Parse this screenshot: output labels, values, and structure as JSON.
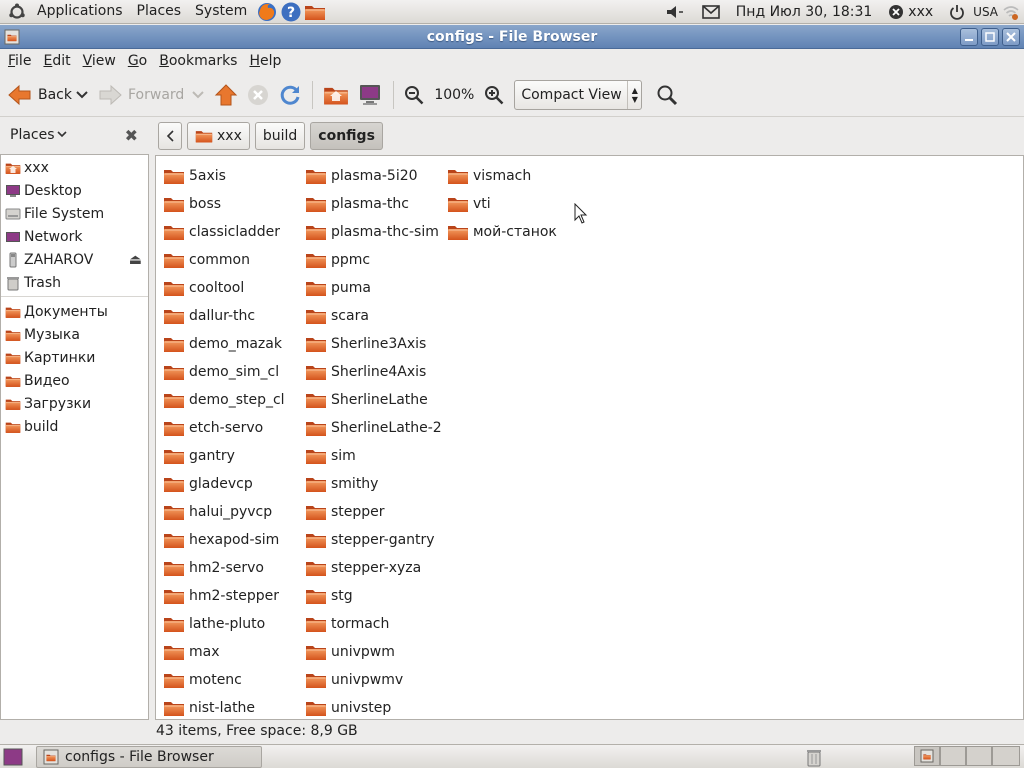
{
  "top_panel": {
    "menus": [
      "Applications",
      "Places",
      "System"
    ],
    "clock": "Пнд Июл 30, 18:31",
    "user": "xxx",
    "keyboard": "USA"
  },
  "window": {
    "title": "configs - File Browser"
  },
  "menubar": {
    "file": "F",
    "file_rest": "ile",
    "edit": "E",
    "edit_rest": "dit",
    "view": "V",
    "view_rest": "iew",
    "go": "G",
    "go_rest": "o",
    "bookmarks": "B",
    "bookmarks_rest": "ookmarks",
    "help": "H",
    "help_rest": "elp"
  },
  "toolbar": {
    "back": "Back",
    "forward": "Forward",
    "zoom": "100%",
    "view_mode": "Compact View"
  },
  "side_pane": {
    "header": "Places",
    "items": [
      {
        "label": "xxx",
        "icon": "home-folder-icon"
      },
      {
        "label": "Desktop",
        "icon": "desktop-icon"
      },
      {
        "label": "File System",
        "icon": "drive-icon"
      },
      {
        "label": "Network",
        "icon": "network-icon"
      },
      {
        "label": "ZAHAROV",
        "icon": "usb-drive-icon"
      },
      {
        "label": "Trash",
        "icon": "trash-icon"
      }
    ],
    "bookmarks": [
      {
        "label": "Документы",
        "icon": "documents-folder-icon"
      },
      {
        "label": "Музыка",
        "icon": "music-folder-icon"
      },
      {
        "label": "Картинки",
        "icon": "pictures-folder-icon"
      },
      {
        "label": "Видео",
        "icon": "videos-folder-icon"
      },
      {
        "label": "Загрузки",
        "icon": "downloads-folder-icon"
      },
      {
        "label": "build",
        "icon": "folder-icon"
      }
    ]
  },
  "path_bar": {
    "segments": [
      "xxx",
      "build",
      "configs"
    ]
  },
  "files": {
    "col1": [
      "5axis",
      "boss",
      "classicladder",
      "common",
      "cooltool",
      "dallur-thc",
      "demo_mazak",
      "demo_sim_cl",
      "demo_step_cl",
      "etch-servo",
      "gantry",
      "gladevcp",
      "halui_pyvcp",
      "hexapod-sim",
      "hm2-servo",
      "hm2-stepper",
      "lathe-pluto",
      "max",
      "motenc",
      "nist-lathe"
    ],
    "col2": [
      "plasma-5i20",
      "plasma-thc",
      "plasma-thc-sim",
      "ppmc",
      "puma",
      "scara",
      "Sherline3Axis",
      "Sherline4Axis",
      "SherlineLathe",
      "SherlineLathe-2",
      "sim",
      "smithy",
      "stepper",
      "stepper-gantry",
      "stepper-xyza",
      "stg",
      "tormach",
      "univpwm",
      "univpwmv",
      "univstep"
    ],
    "col3": [
      "vismach",
      "vti",
      "мой-станок"
    ]
  },
  "status": "43 items, Free space: 8,9 GB",
  "taskbar": {
    "task": "configs - File Browser"
  },
  "colors": {
    "title_bar": "#6f8fbd",
    "folder": "#e0632a"
  }
}
